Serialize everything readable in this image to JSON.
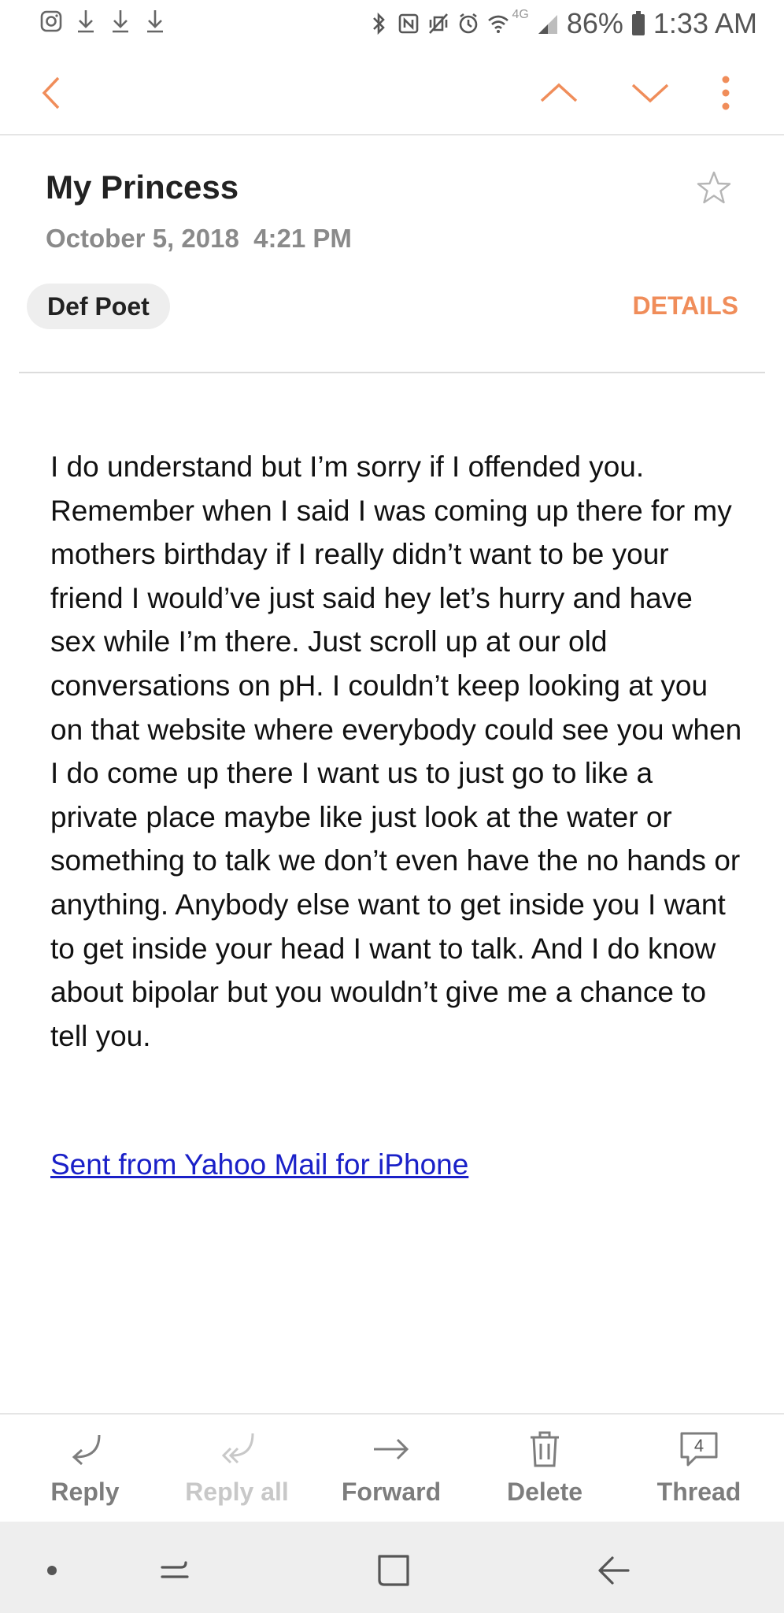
{
  "status_bar": {
    "battery": "86%",
    "time": "1:33 AM",
    "network": "4G",
    "left_icons": [
      "instagram-icon",
      "download-icon",
      "download-icon",
      "download-icon"
    ],
    "right_icons": [
      "bluetooth-icon",
      "nfc-icon",
      "vibrate-icon",
      "alarm-icon",
      "wifi-icon",
      "signal-icon",
      "battery-icon"
    ]
  },
  "top_bar": {
    "icons": [
      "back-arrow-icon",
      "previous-email-icon",
      "next-email-icon",
      "more-vert-icon"
    ],
    "accent_color": "#f08d5a"
  },
  "email": {
    "subject": "My Princess",
    "date": "October 5, 2018  4:21 PM",
    "sender": "Def Poet",
    "details_label": "DETAILS",
    "body": "I do understand but I’m sorry if I offended you. Remember when I said I was coming up there for my mothers birthday if I really didn’t want to be your friend I would’ve just said hey let’s hurry and have sex while I’m there. Just scroll up at our old conversations on pH. I couldn’t keep looking at you on that website where everybody could see you when I do come up there I want us to just go to like a private place maybe like just look at the water or something to talk we don’t even have the no hands or anything. Anybody else want to get inside you I want to get inside your head I want to talk. And I do know about bipolar but you wouldn’t give me a chance to tell you.",
    "signature": "Sent from Yahoo Mail for iPhone",
    "link_color": "#1a20c8"
  },
  "actions": [
    {
      "label": "Reply",
      "icon": "reply-icon",
      "enabled": true
    },
    {
      "label": "Reply all",
      "icon": "reply-all-icon",
      "enabled": false
    },
    {
      "label": "Forward",
      "icon": "forward-icon",
      "enabled": true
    },
    {
      "label": "Delete",
      "icon": "trash-icon",
      "enabled": true
    },
    {
      "label": "Thread",
      "icon": "thread-icon",
      "enabled": true,
      "badge": "4"
    }
  ],
  "nav_bar": {
    "icons": [
      "nav-dot-icon",
      "recent-apps-icon",
      "home-icon",
      "nav-back-icon"
    ]
  }
}
